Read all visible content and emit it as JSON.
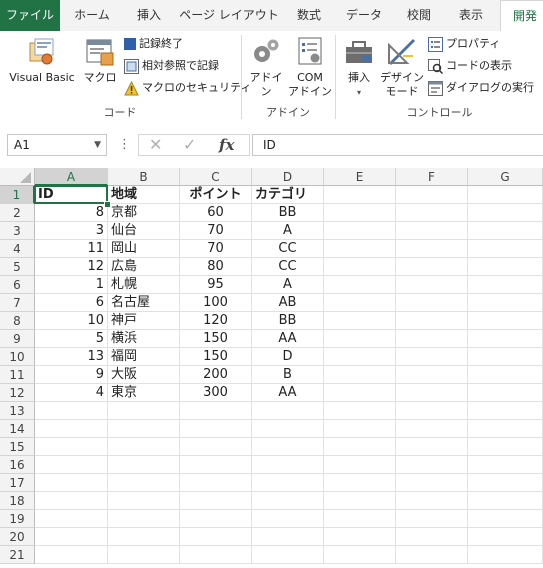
{
  "tabs": [
    {
      "label": "ファイル",
      "kind": "file"
    },
    {
      "label": "ホーム"
    },
    {
      "label": "挿入"
    },
    {
      "label": "ページ レイアウト"
    },
    {
      "label": "数式"
    },
    {
      "label": "データ"
    },
    {
      "label": "校閲"
    },
    {
      "label": "表示"
    },
    {
      "label": "開発",
      "kind": "active"
    }
  ],
  "ribbon": {
    "code": {
      "label": "コード",
      "visual_basic": "Visual Basic",
      "macro": "マクロ",
      "stop_recording": "記録終了",
      "relative_ref": "相対参照で記録",
      "macro_security": "マクロのセキュリティ"
    },
    "addin": {
      "label": "アドイン",
      "addin": "アドイン",
      "com_line1": "COM",
      "com_line2": "アドイン"
    },
    "control": {
      "label": "コントロール",
      "insert": "挿入",
      "design_line1": "デザイン",
      "design_line2": "モード",
      "properties": "プロパティ",
      "view_code": "コードの表示",
      "run_dialog": "ダイアログの実行"
    }
  },
  "formula_bar": {
    "name_box": "A1",
    "fx": "fx",
    "content": "ID"
  },
  "columns": [
    "A",
    "B",
    "C",
    "D",
    "E",
    "F",
    "G"
  ],
  "rows": [
    "1",
    "2",
    "3",
    "4",
    "5",
    "6",
    "7",
    "8",
    "9",
    "10",
    "11",
    "12",
    "13",
    "14",
    "15",
    "16",
    "17",
    "18",
    "19",
    "20",
    "21"
  ],
  "table": {
    "headers": [
      "ID",
      "地域",
      "ポイント",
      "カテゴリ"
    ],
    "rows": [
      [
        "8",
        "京都",
        "60",
        "BB"
      ],
      [
        "3",
        "仙台",
        "70",
        "A"
      ],
      [
        "11",
        "岡山",
        "70",
        "CC"
      ],
      [
        "12",
        "広島",
        "80",
        "CC"
      ],
      [
        "1",
        "札幌",
        "95",
        "A"
      ],
      [
        "6",
        "名古屋",
        "100",
        "AB"
      ],
      [
        "10",
        "神戸",
        "120",
        "BB"
      ],
      [
        "5",
        "横浜",
        "150",
        "AA"
      ],
      [
        "13",
        "福岡",
        "150",
        "D"
      ],
      [
        "9",
        "大阪",
        "200",
        "B"
      ],
      [
        "4",
        "東京",
        "300",
        "AA"
      ]
    ]
  },
  "colors": {
    "accent": "#217346"
  }
}
